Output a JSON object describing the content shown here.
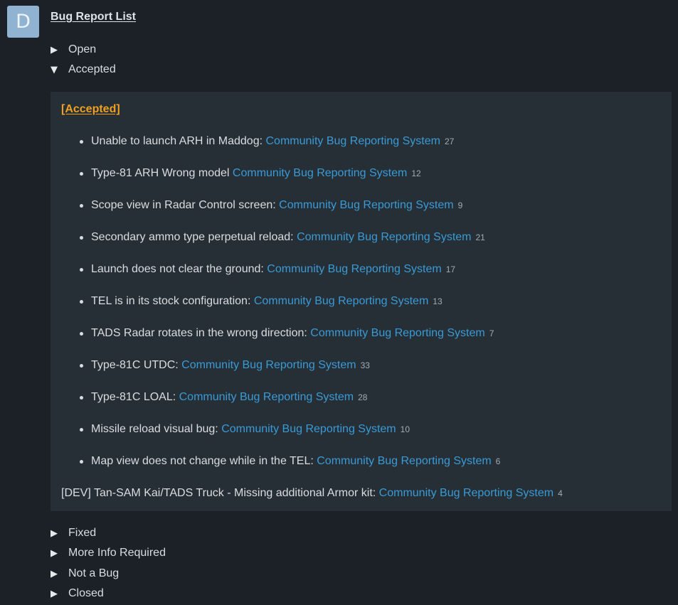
{
  "avatar": {
    "letter": "D"
  },
  "page": {
    "title": "Bug Report List"
  },
  "sections": {
    "open": {
      "arrow": "▶",
      "label": "Open"
    },
    "accepted": {
      "arrow": "▼",
      "label": "Accepted"
    },
    "fixed": {
      "arrow": "▶",
      "label": "Fixed"
    },
    "more_info": {
      "arrow": "▶",
      "label": "More Info Required"
    },
    "not_a_bug": {
      "arrow": "▶",
      "label": "Not a Bug"
    },
    "closed": {
      "arrow": "▶",
      "label": "Closed"
    }
  },
  "accepted_panel": {
    "heading": "[Accepted]",
    "items": [
      {
        "text": "Unable to launch ARH in Maddog:",
        "link": "Community Bug Reporting System",
        "count": "27"
      },
      {
        "text": "Type-81 ARH Wrong model",
        "link": "Community Bug Reporting System",
        "count": "12"
      },
      {
        "text": "Scope view in Radar Control screen:",
        "link": "Community Bug Reporting System",
        "count": "9"
      },
      {
        "text": "Secondary ammo type perpetual reload:",
        "link": "Community Bug Reporting System",
        "count": "21"
      },
      {
        "text": "Launch does not clear the ground:",
        "link": "Community Bug Reporting System",
        "count": "17"
      },
      {
        "text": "TEL is in its stock configuration:",
        "link": "Community Bug Reporting System",
        "count": "13"
      },
      {
        "text": "TADS Radar rotates in the wrong direction:",
        "link": "Community Bug Reporting System",
        "count": "7"
      },
      {
        "text": "Type-81C UTDC:",
        "link": "Community Bug Reporting System",
        "count": "33"
      },
      {
        "text": "Type-81C LOAL:",
        "link": "Community Bug Reporting System",
        "count": "28"
      },
      {
        "text": "Missile reload visual bug:",
        "link": "Community Bug Reporting System",
        "count": "10"
      },
      {
        "text": "Map view does not change while in the TEL:",
        "link": "Community Bug Reporting System",
        "count": "6"
      }
    ],
    "dev_item": {
      "text": "[DEV] Tan-SAM Kai/TADS Truck - Missing additional Armor kit:",
      "link": "Community Bug Reporting System",
      "count": "4"
    }
  },
  "colors": {
    "background": "#1b2126",
    "panel": "#262f35",
    "link": "#3a9ad6",
    "heading_accent": "#f0a020",
    "avatar": "#8fb3d1"
  }
}
